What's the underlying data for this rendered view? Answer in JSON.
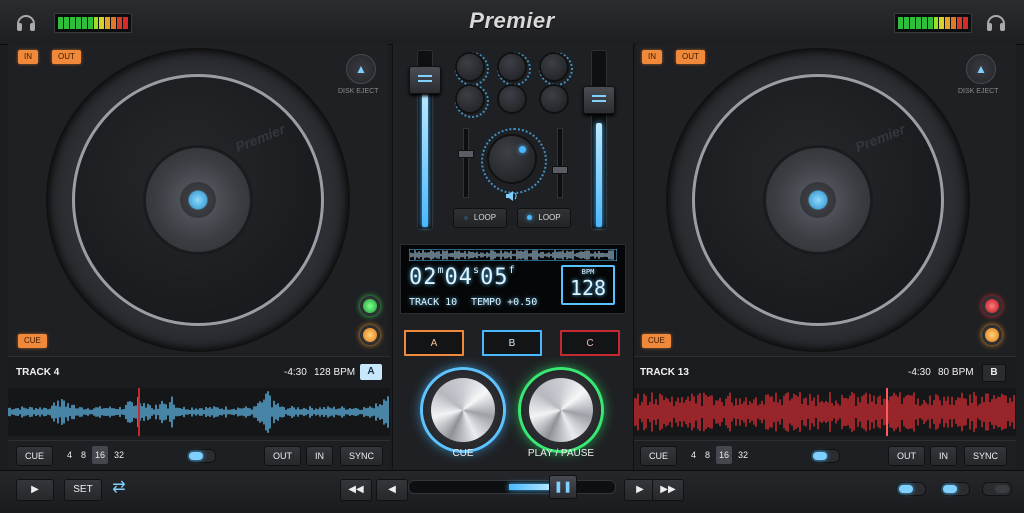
{
  "app": {
    "title": "Premier"
  },
  "colors": {
    "accent": "#4ab8ff",
    "cue_orange": "#f08a3a",
    "deck_b_wave": "#c42a2f",
    "play_ring": "#2ee06a"
  },
  "deck_left": {
    "in_label": "IN",
    "out_label": "OUT",
    "cue_label": "CUE",
    "eject_label": "DISK EJECT",
    "platter_stamp": "Premier",
    "track_name": "TRACK 4",
    "time": "-4:30",
    "bpm": "128 BPM",
    "deck_letter": "A",
    "controls": {
      "cue": "CUE",
      "beats": [
        "4",
        "8",
        "16",
        "32"
      ],
      "selected_beat": "16",
      "out": "OUT",
      "in": "IN",
      "sync": "SYNC"
    },
    "led_top": "green-led",
    "led_bottom": "orange-led",
    "wave_color": "#5aa9d6"
  },
  "deck_right": {
    "in_label": "IN",
    "out_label": "OUT",
    "cue_label": "CUE",
    "eject_label": "DISK EJECT",
    "platter_stamp": "Premier",
    "track_name": "TRACK 13",
    "time": "-4:30",
    "bpm": "80 BPM",
    "deck_letter": "B",
    "controls": {
      "cue": "CUE",
      "beats": [
        "4",
        "8",
        "16",
        "32"
      ],
      "selected_beat": "16",
      "out": "OUT",
      "in": "IN",
      "sync": "SYNC"
    },
    "led_top": "red-led",
    "led_bottom": "orange-led",
    "wave_color": "#c42a2f"
  },
  "mixer": {
    "loop_left": "LOOP",
    "loop_right": "LOOP",
    "volume_icon": "speaker-icon",
    "lcd": {
      "m": "02",
      "m_unit": "m",
      "s": "04",
      "s_unit": "s",
      "f": "05",
      "f_unit": "f",
      "track": "TRACK 10",
      "tempo": "TEMPO +0.50",
      "bpm_label": "BPM",
      "bpm": "128"
    },
    "buttons": [
      "A",
      "B",
      "C"
    ],
    "cue_label": "CUE",
    "play_label": "PLAY / PAUSE"
  },
  "bottom": {
    "play_icon": "play-icon",
    "set_label": "SET",
    "loop_icon": "repeat-icon",
    "rewind_icon": "rewind-icon",
    "prev_icon": "prev-icon",
    "pitch_icon": "pause-icon",
    "next_icon": "next-icon",
    "forward_icon": "fast-forward-icon"
  }
}
